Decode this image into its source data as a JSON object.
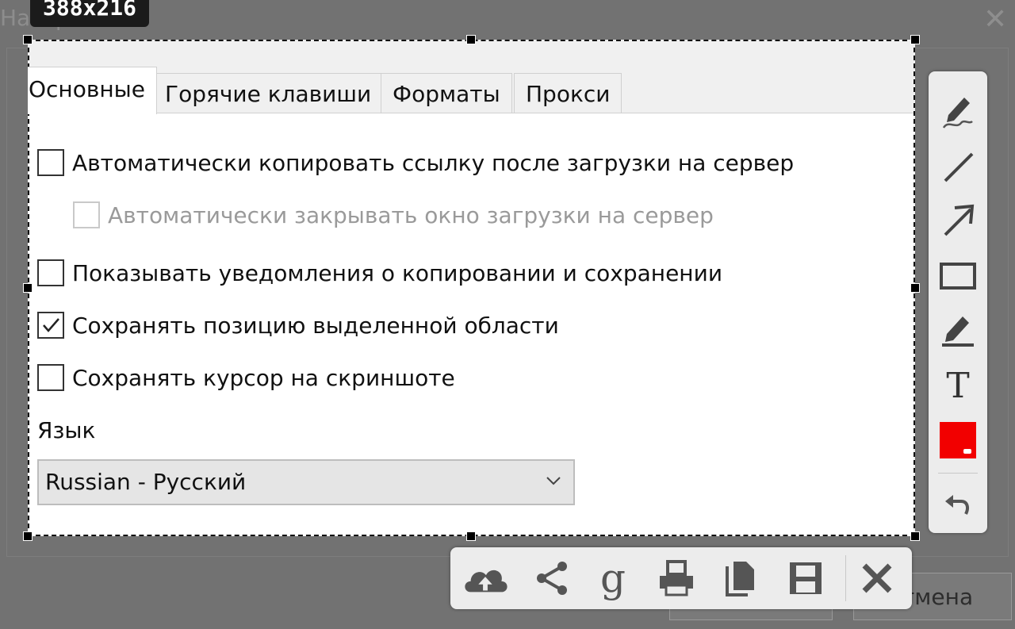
{
  "background_dialog": {
    "title": "Настройки",
    "ok_label": "",
    "cancel_label": "тмена"
  },
  "selection": {
    "size_label": "388x216"
  },
  "tabs": [
    {
      "label": "Основные",
      "active": true
    },
    {
      "label": "Горячие клавиши",
      "active": false
    },
    {
      "label": "Форматы",
      "active": false
    },
    {
      "label": "Прокси",
      "active": false
    }
  ],
  "options": [
    {
      "label": "Автоматически копировать ссылку после загрузки на сервер",
      "checked": false,
      "enabled": true
    },
    {
      "label": "Автоматически закрывать окно загрузки на сервер",
      "checked": false,
      "enabled": false
    },
    {
      "label": "Показывать уведомления о копировании и сохранении",
      "checked": false,
      "enabled": true
    },
    {
      "label": "Сохранять позицию выделенной области",
      "checked": true,
      "enabled": true
    },
    {
      "label": "Сохранять курсор на скриншоте",
      "checked": false,
      "enabled": true
    }
  ],
  "language": {
    "label": "Язык",
    "selected": "Russian - Русский"
  },
  "right_toolbar": {
    "tools": [
      "pen-icon",
      "line-icon",
      "arrow-icon",
      "rectangle-icon",
      "marker-icon",
      "text-icon",
      "color-picker",
      "undo-icon"
    ],
    "color": "#f20000",
    "text_tool_glyph": "T"
  },
  "bottom_toolbar": {
    "tools": [
      "cloud-upload-icon",
      "share-icon",
      "google-search-icon",
      "print-icon",
      "copy-icon",
      "save-icon",
      "close-icon"
    ],
    "google_glyph": "g"
  }
}
